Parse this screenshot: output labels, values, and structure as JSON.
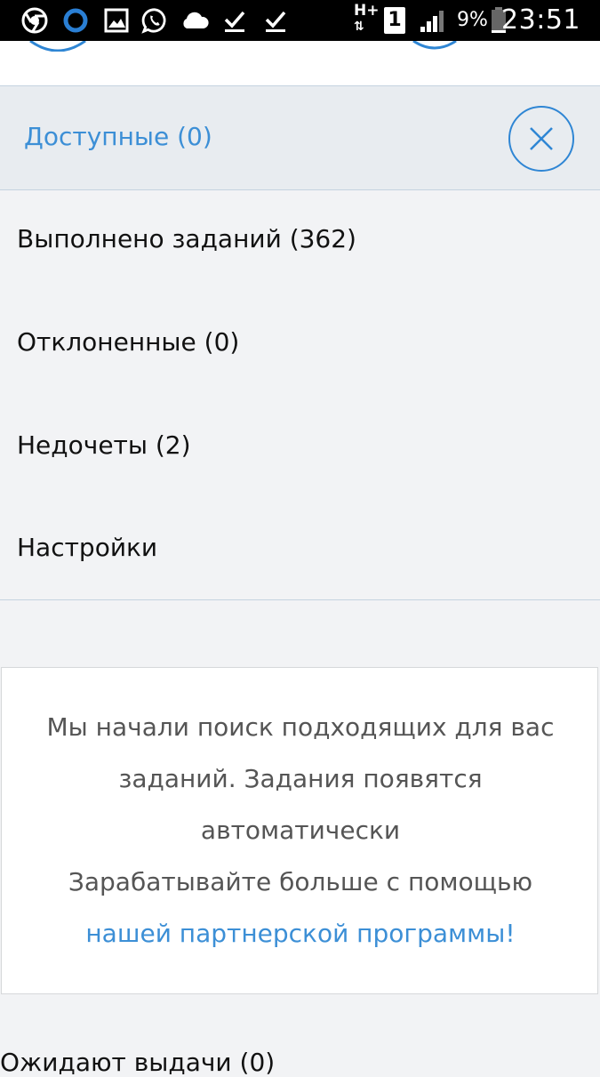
{
  "status_bar": {
    "network": "H+",
    "sim": "1",
    "battery": "9%",
    "time": "23:51",
    "icons": [
      "chrome-icon",
      "circle-app-icon",
      "gallery-icon",
      "whatsapp-icon",
      "cloud-icon",
      "download-done-icon",
      "download-done-icon"
    ]
  },
  "menu": {
    "active_label": "Доступные (0)",
    "items": [
      {
        "label": "Выполнено заданий (362)"
      },
      {
        "label": "Отклоненные (0)"
      },
      {
        "label": "Недочеты (2)"
      },
      {
        "label": "Настройки"
      }
    ]
  },
  "info_card": {
    "line1": "Мы начали поиск подходящих для вас",
    "line2": "заданий. Задания появятся",
    "line3": "автоматически",
    "line4": "Зарабатывайте больше с помощью",
    "link": "нашей партнерской программы!"
  },
  "bottom_item": "Ожидают выдачи (0)",
  "colors": {
    "accent": "#3c8fd6",
    "menu_bg": "#e8ecf0",
    "page_bg": "#f2f3f5"
  }
}
